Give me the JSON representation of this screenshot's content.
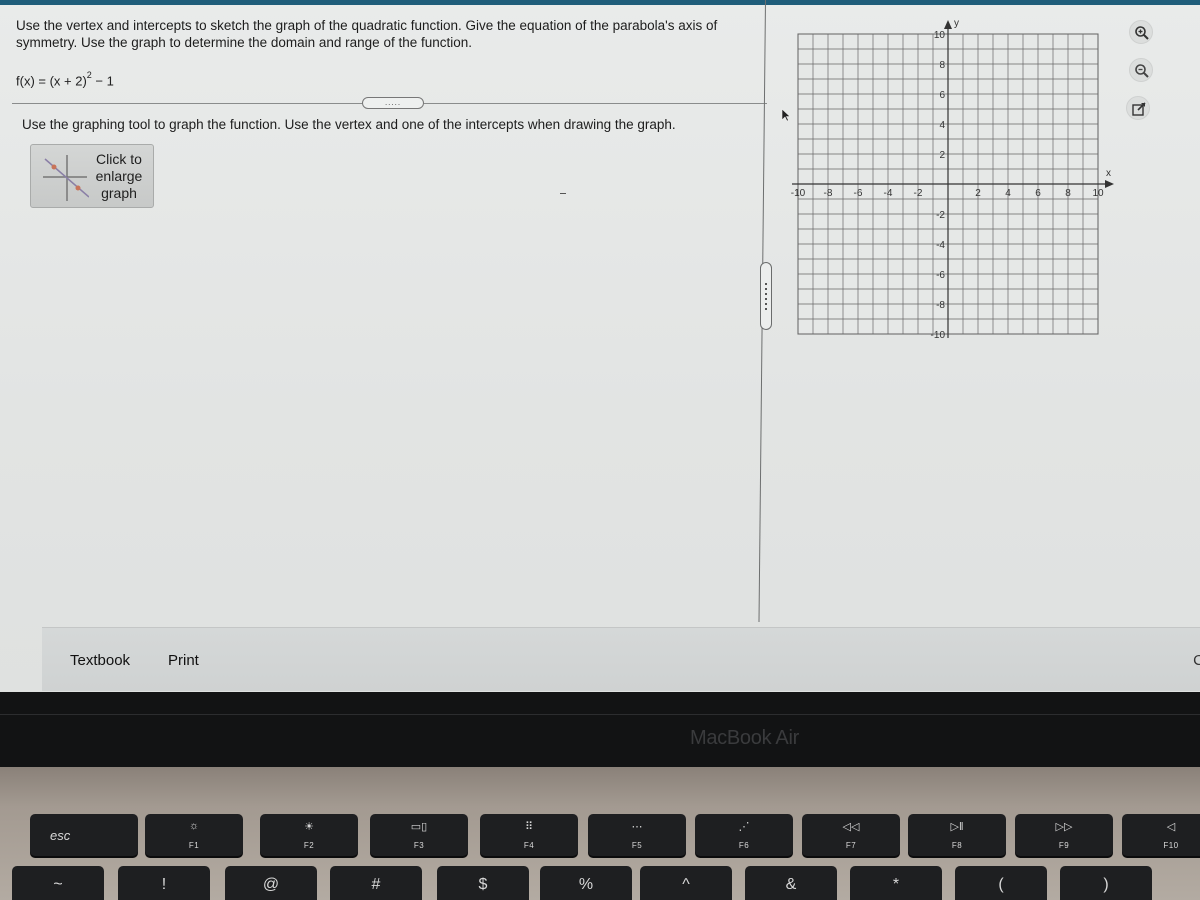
{
  "question": {
    "prompt": "Use the vertex and intercepts to sketch the graph of the quadratic function.  Give the equation of the parabola's axis of symmetry. Use the graph to determine the domain and range of the function.",
    "function_lhs": "f(x) = (x + 2)",
    "function_exponent": "2",
    "function_rhs": " − 1",
    "expand_toggle": ".....",
    "instruction": "Use the graphing tool to graph the function.  Use the vertex and one of the intercepts when drawing the graph.",
    "enlarge_button_label": "Click to enlarge graph"
  },
  "graph": {
    "x_axis_label": "x",
    "y_axis_label": "y",
    "x_range": [
      -10,
      10
    ],
    "y_range": [
      -10,
      10
    ],
    "grid_step": 1,
    "x_tick_labels": [
      "-10",
      "-8",
      "-6",
      "-4",
      "-2",
      "2",
      "4",
      "6",
      "8",
      "10"
    ],
    "y_tick_labels": [
      "10",
      "8",
      "6",
      "4",
      "2",
      "-2",
      "-4",
      "-6",
      "-8",
      "-10"
    ]
  },
  "tools": {
    "zoom_in": "zoom-in",
    "zoom_out": "zoom-out",
    "popout": "open-in-new-window"
  },
  "bottom_bar": {
    "textbook": "Textbook",
    "print": "Print",
    "right_cut": "C"
  },
  "device": {
    "brand": "MacBook Air"
  },
  "keyboard": {
    "function_row": [
      {
        "label": "esc",
        "glyph": ""
      },
      {
        "label": "F1",
        "glyph": "☼"
      },
      {
        "label": "F2",
        "glyph": "☀"
      },
      {
        "label": "F3",
        "glyph": "▭▯"
      },
      {
        "label": "F4",
        "glyph": "⠿"
      },
      {
        "label": "F5",
        "glyph": "⋯"
      },
      {
        "label": "F6",
        "glyph": "⋰"
      },
      {
        "label": "F7",
        "glyph": "◁◁"
      },
      {
        "label": "F8",
        "glyph": "▷‖"
      },
      {
        "label": "F9",
        "glyph": "▷▷"
      },
      {
        "label": "F10",
        "glyph": "◁"
      }
    ],
    "number_row": [
      "~",
      "!",
      "@",
      "#",
      "$",
      "%",
      "^",
      "&",
      "*",
      "(",
      ")"
    ]
  }
}
